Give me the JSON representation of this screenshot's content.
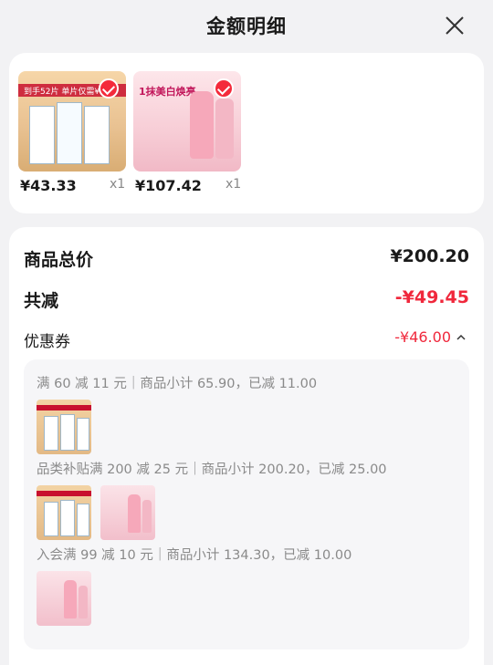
{
  "header": {
    "title": "金额明细"
  },
  "products": [
    {
      "price": "¥43.33",
      "qty": "x1",
      "image_text": "到手52片 单片仅需¥1.3"
    },
    {
      "price": "¥107.42",
      "qty": "x1",
      "image_text": "1抹美白焕亮"
    }
  ],
  "summary": {
    "total_label": "商品总价",
    "total_value": "¥200.20",
    "discount_label": "共减",
    "discount_value": "-¥49.45",
    "coupon_label": "优惠券",
    "coupon_value": "-¥46.00"
  },
  "discount_rules": [
    {
      "text": "满 60 减 11 元｜商品小计 65.90，已减 11.00",
      "thumbs": [
        "gold"
      ]
    },
    {
      "text": "品类补贴满 200 减 25 元｜商品小计 200.20，已减 25.00",
      "thumbs": [
        "gold",
        "pink"
      ]
    },
    {
      "text": "入会满 99 减 10 元｜商品小计 134.30，已减 10.00",
      "thumbs": [
        "pink"
      ]
    }
  ],
  "colors": {
    "accent_red": "#f0283c",
    "check_red": "#f42a3b",
    "background": "#f2f2f4"
  },
  "icons": [
    "close-icon",
    "check-icon",
    "chevron-up-icon"
  ]
}
